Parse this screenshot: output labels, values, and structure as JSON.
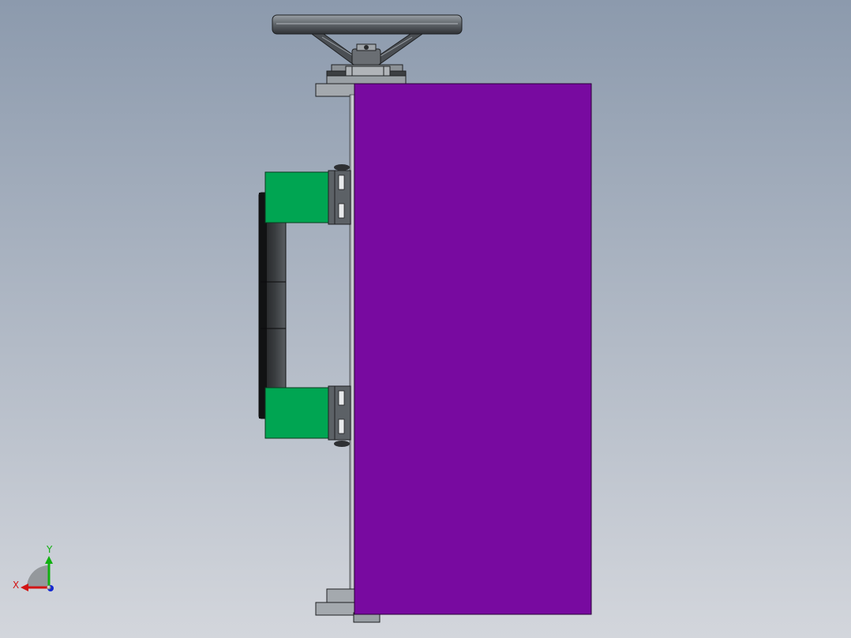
{
  "viewport": {
    "background_top": "#8c9aad",
    "background_bottom": "#d3d6dc"
  },
  "colors": {
    "housing": "#780aa0",
    "bracket": "#00a552",
    "steel": "#8c9196",
    "dark_steel": "#3c3f42",
    "motor": "#2a2c2e",
    "handwheel": "#5a5e64"
  },
  "triad": {
    "x_label": "X",
    "y_label": "Y",
    "x_color": "#d21414",
    "y_color": "#10b010",
    "z_color": "#1428d2"
  }
}
